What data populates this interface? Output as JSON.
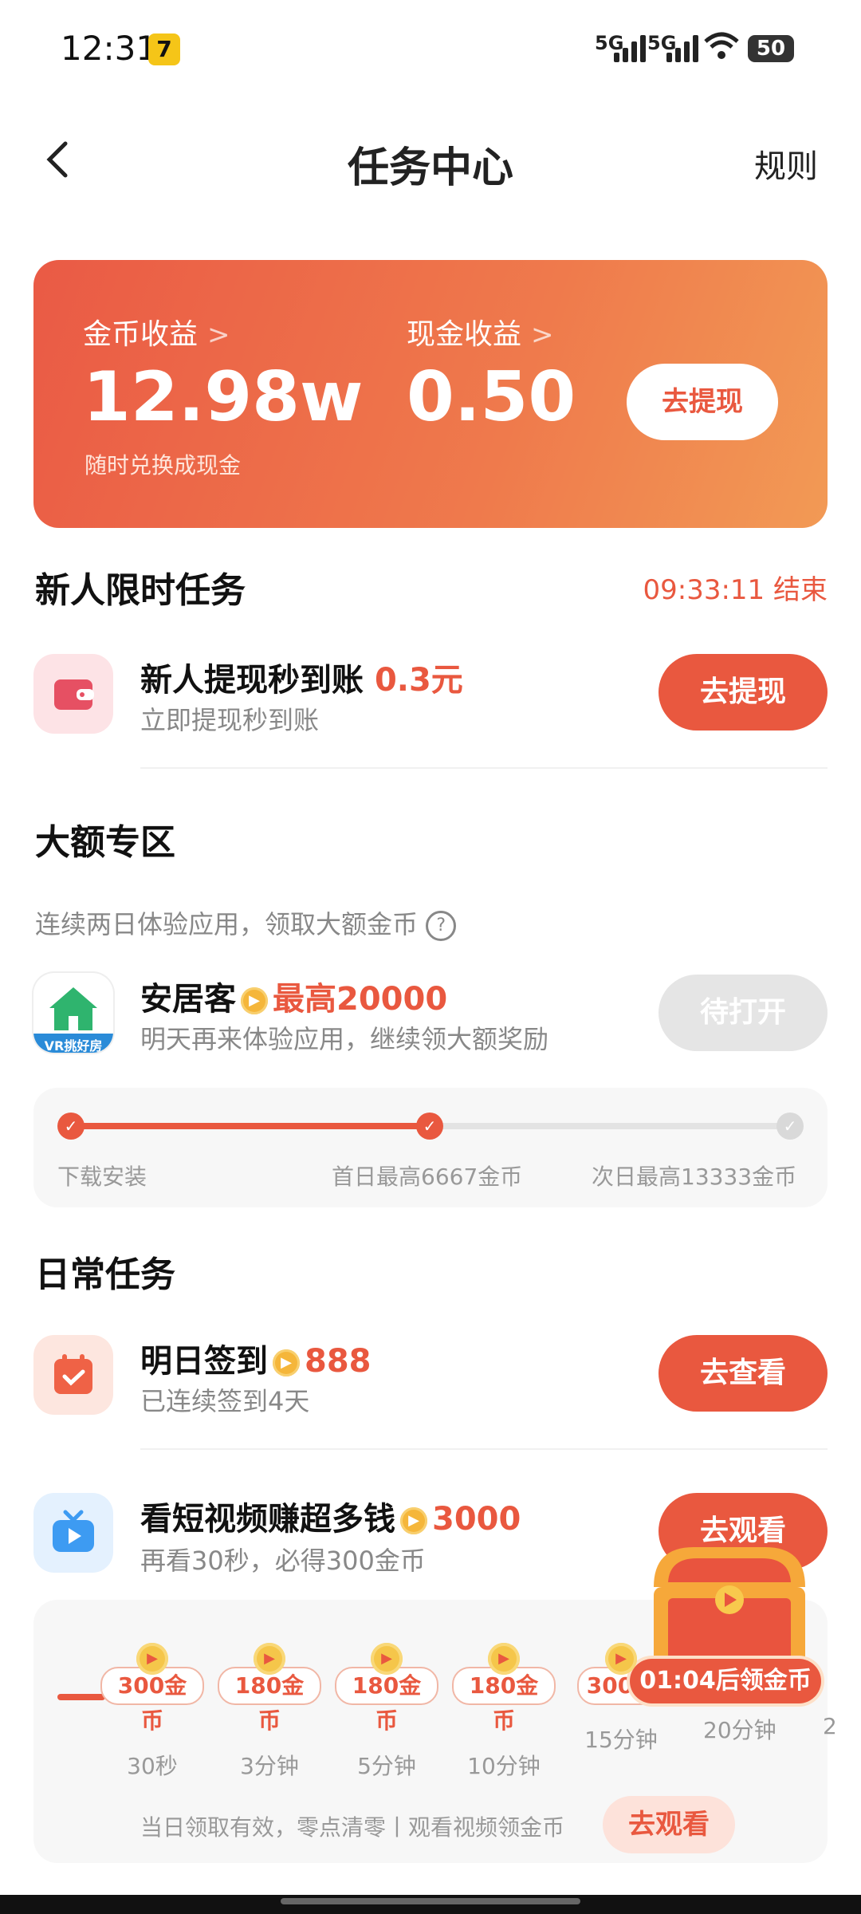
{
  "status_bar": {
    "time": "12:31",
    "app_icon": "7",
    "sig1": "5G",
    "sig2": "5G",
    "battery": "50"
  },
  "header": {
    "title": "任务中心",
    "rules": "规则"
  },
  "earnings": {
    "coin_label": "金币收益",
    "coin_value": "12.98w",
    "coin_sub": "随时兑换成现金",
    "cash_label": "现金收益",
    "cash_value": "0.50",
    "withdraw_btn": "去提现"
  },
  "newbie": {
    "title": "新人限时任务",
    "timer": "09:33:11 结束",
    "item": {
      "title": "新人提现秒到账",
      "highlight": "0.3元",
      "sub": "立即提现秒到账",
      "button": "去提现"
    }
  },
  "big_zone": {
    "title": "大额专区",
    "desc": "连续两日体验应用，领取大额金币",
    "app": {
      "name": "安居客",
      "highlight": "最高20000",
      "sub": "明天再来体验应用，继续领大额奖励",
      "button": "待打开",
      "logo_text": "VR挑好房"
    },
    "progress": {
      "steps": [
        "下载安装",
        "首日最高6667金币",
        "次日最高13333金币"
      ],
      "completed": 2
    }
  },
  "daily": {
    "title": "日常任务",
    "signin": {
      "title": "明日签到",
      "reward": "888",
      "sub": "已连续签到4天",
      "button": "去查看"
    },
    "video": {
      "title": "看短视频赚超多钱",
      "reward": "3000",
      "sub": "再看30秒，必得300金币",
      "button": "去观看"
    },
    "video_steps": [
      {
        "coins": "300金币",
        "time": "30秒"
      },
      {
        "coins": "180金币",
        "time": "3分钟"
      },
      {
        "coins": "180金币",
        "time": "5分钟"
      },
      {
        "coins": "180金币",
        "time": "10分钟"
      },
      {
        "coins": "300金",
        "time": "15分钟"
      },
      {
        "coins": "",
        "time": "20分钟"
      },
      {
        "coins": "",
        "time": "2"
      }
    ],
    "footer_note": "当日领取有效，零点清零丨观看视频领金币",
    "footer_button": "去观看"
  },
  "chest": {
    "timer": "01:04后领金币"
  },
  "colors": {
    "accent": "#e9583f",
    "card_start": "#ea5a45",
    "card_end": "#f29a55"
  }
}
